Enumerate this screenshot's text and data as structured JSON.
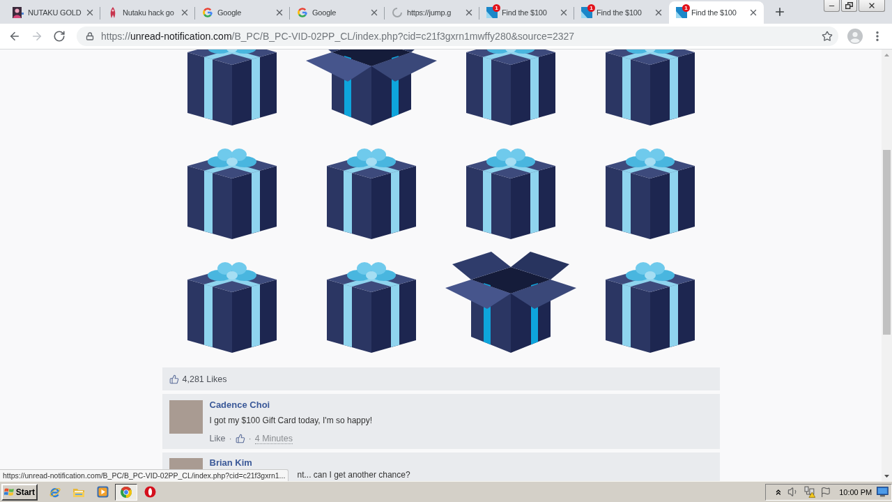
{
  "tabs": [
    {
      "kind": "portrait",
      "title": "NUTAKU GOLD",
      "selected": false
    },
    {
      "kind": "figure",
      "title": "Nutaku hack go",
      "selected": false
    },
    {
      "kind": "google",
      "title": "Google",
      "selected": false
    },
    {
      "kind": "google",
      "title": "Google",
      "selected": false
    },
    {
      "kind": "loading",
      "title": "https://jump.g",
      "selected": false
    },
    {
      "kind": "alert",
      "badge": "1",
      "title": "Find the $100",
      "selected": false
    },
    {
      "kind": "alert",
      "badge": "1",
      "title": "Find the $100",
      "selected": false
    },
    {
      "kind": "alert",
      "badge": "1",
      "title": "Find the $100",
      "selected": true
    }
  ],
  "toolbar": {
    "nav": [
      {
        "kind": "back",
        "disabled": false
      },
      {
        "kind": "forward",
        "disabled": true
      },
      {
        "kind": "reload",
        "disabled": false
      }
    ],
    "url": {
      "scheme": "https://",
      "host": "unread-notification.com",
      "path": "/B_PC/B_PC-VID-02PP_CL/index.php?cid=c21f3gxrn1mwffy280&source=2327"
    }
  },
  "gift_grid": {
    "rows": [
      {
        "boxes": [
          {
            "kind": "gift"
          },
          {
            "kind": "open"
          },
          {
            "kind": "gift"
          },
          {
            "kind": "gift"
          }
        ]
      },
      {
        "boxes": [
          {
            "kind": "gift"
          },
          {
            "kind": "gift"
          },
          {
            "kind": "gift"
          },
          {
            "kind": "gift"
          }
        ]
      },
      {
        "boxes": [
          {
            "kind": "gift"
          },
          {
            "kind": "gift"
          },
          {
            "kind": "open"
          },
          {
            "kind": "gift"
          }
        ]
      }
    ]
  },
  "likes": {
    "text": "4,281 Likes"
  },
  "comments": [
    {
      "name": "Cadence Choi",
      "text": "I got my $100 Gift Card today, I'm so happy!",
      "meta": [
        {
          "kind": "link",
          "text": "Like"
        },
        {
          "kind": "dot",
          "text": "·"
        },
        {
          "kind": "thumb"
        },
        {
          "kind": "dot",
          "text": "·"
        },
        {
          "kind": "time",
          "text": "4 Minutes"
        }
      ]
    },
    {
      "name": "Brian Kim",
      "text": "nt... can I get another chance?"
    }
  ],
  "status_bubble": {
    "url": "https://unread-notification.com/B_PC/B_PC-VID-02PP_CL/index.php?cid=c21f3gxrn1..."
  },
  "taskbar": {
    "start": "Start",
    "apps": [
      {
        "kind": "ie",
        "selected": false
      },
      {
        "kind": "folder",
        "selected": false
      },
      {
        "kind": "media",
        "selected": false
      },
      {
        "kind": "chrome",
        "selected": true
      },
      {
        "kind": "opera",
        "selected": false
      }
    ],
    "tray": {
      "clock": "10:00 PM"
    }
  }
}
